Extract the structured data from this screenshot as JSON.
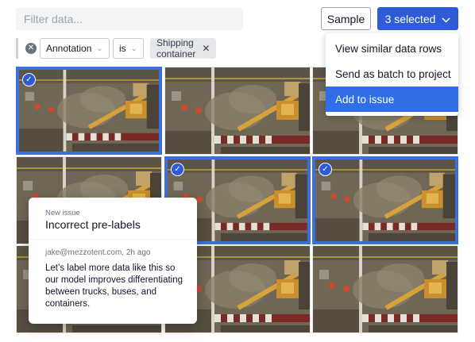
{
  "search": {
    "placeholder": "Filter data..."
  },
  "toolbar": {
    "sample_label": "Sample",
    "selected_label": "3 selected"
  },
  "filters": {
    "field": "Annotation",
    "operator": "is",
    "value": "Shipping container"
  },
  "menu": {
    "items": [
      {
        "label": "View similar data rows",
        "active": false
      },
      {
        "label": "Send as batch to project",
        "active": false
      },
      {
        "label": "Add to issue",
        "active": true
      }
    ]
  },
  "tiles": [
    {
      "row": 0,
      "col": 0,
      "selected": true
    },
    {
      "row": 0,
      "col": 1,
      "selected": false
    },
    {
      "row": 0,
      "col": 2,
      "selected": false
    },
    {
      "row": 1,
      "col": 0,
      "selected": false
    },
    {
      "row": 1,
      "col": 1,
      "selected": true
    },
    {
      "row": 1,
      "col": 2,
      "selected": true
    },
    {
      "row": 2,
      "col": 0,
      "selected": false
    },
    {
      "row": 2,
      "col": 1,
      "selected": false
    },
    {
      "row": 2,
      "col": 2,
      "selected": false
    }
  ],
  "issue_card": {
    "kicker": "New issue",
    "title": "Incorrect pre-labels",
    "author": "jake@mezzotent.com, 2h ago",
    "body": "Let’s label more data like this so our model improves differentiating between trucks, buses, and containers."
  },
  "colors": {
    "accent": "#2f5bd8",
    "selection": "#3b6fe0",
    "menu_active": "#2f6ee6"
  }
}
